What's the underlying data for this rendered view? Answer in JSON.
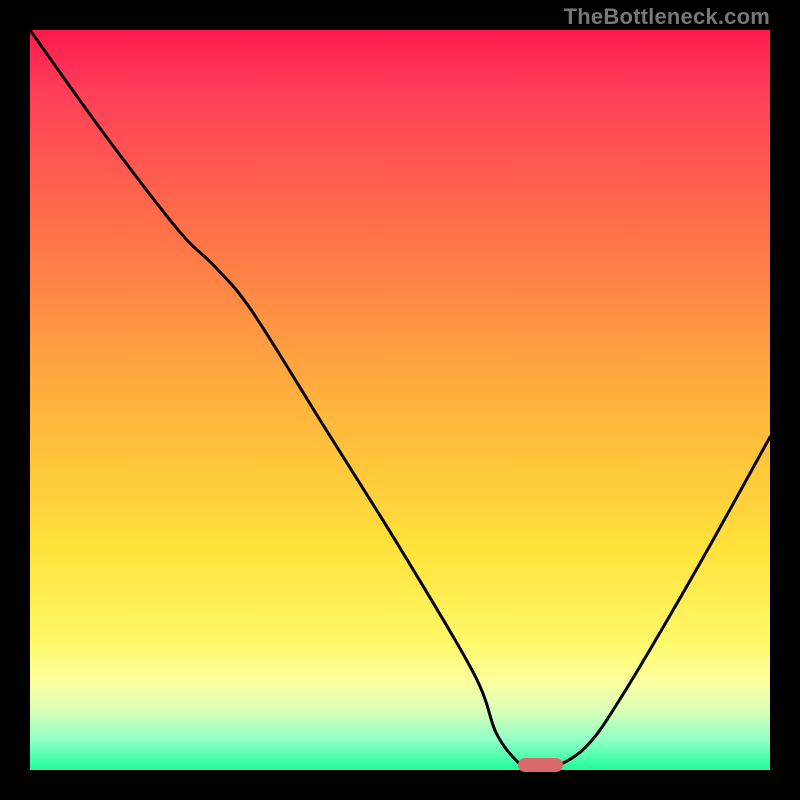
{
  "watermark": "TheBottleneck.com",
  "colors": {
    "background": "#000000",
    "gradient_top": "#ff1a4d",
    "gradient_mid": "#ffe23a",
    "gradient_bottom": "#1eff9a",
    "curve": "#000000",
    "marker": "#d86a6a"
  },
  "chart_data": {
    "type": "line",
    "title": "",
    "xlabel": "",
    "ylabel": "",
    "xlim": [
      0,
      100
    ],
    "ylim": [
      0,
      100
    ],
    "x": [
      0,
      10,
      20,
      25,
      30,
      40,
      50,
      60,
      63,
      66,
      68,
      70,
      75,
      80,
      90,
      100
    ],
    "values": [
      100,
      86,
      73,
      68,
      62,
      46,
      30,
      13,
      5,
      1,
      0,
      0,
      3,
      10,
      27,
      45
    ],
    "marker_x_range": [
      66,
      72
    ],
    "annotations": []
  }
}
